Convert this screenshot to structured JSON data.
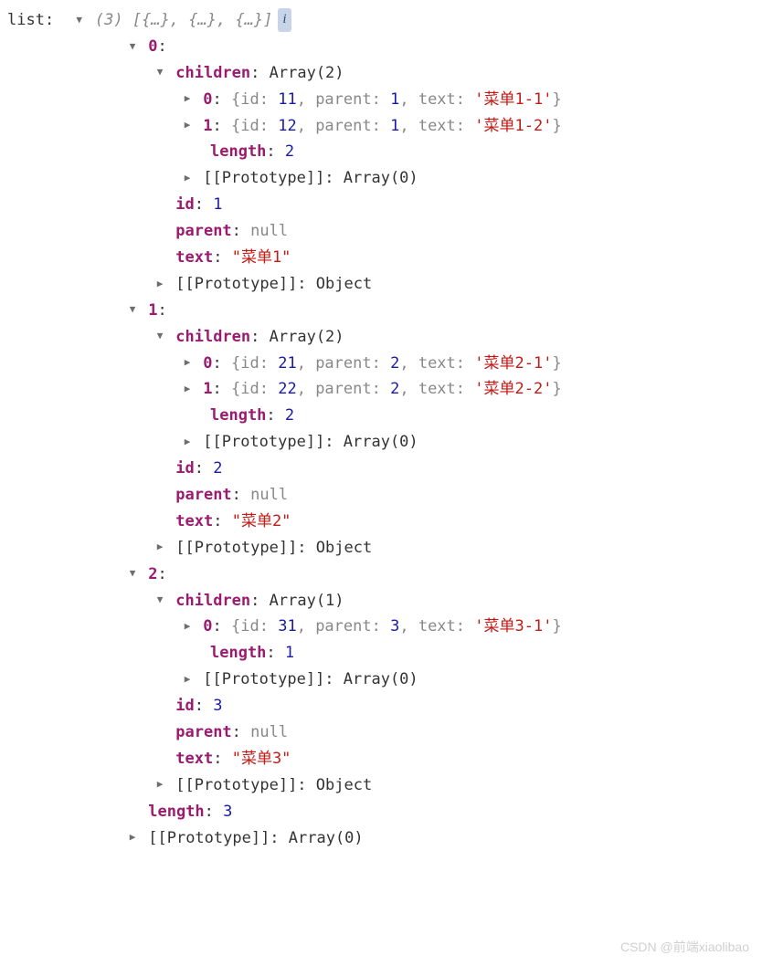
{
  "root": {
    "label": "list",
    "summary_count": "(3)",
    "summary_preview": "[{…}, {…}, {…}]",
    "info_badge": "i"
  },
  "items": [
    {
      "index": "0",
      "children_label": "children",
      "children_summary": "Array(2)",
      "child_rows": [
        {
          "idx": "0",
          "id": "11",
          "parent": "1",
          "text": "'菜单1-1'"
        },
        {
          "idx": "1",
          "id": "12",
          "parent": "1",
          "text": "'菜单1-2'"
        }
      ],
      "children_length": "2",
      "children_proto": "Array(0)",
      "id": "1",
      "parent": "null",
      "text": "\"菜单1\"",
      "proto": "Object"
    },
    {
      "index": "1",
      "children_label": "children",
      "children_summary": "Array(2)",
      "child_rows": [
        {
          "idx": "0",
          "id": "21",
          "parent": "2",
          "text": "'菜单2-1'"
        },
        {
          "idx": "1",
          "id": "22",
          "parent": "2",
          "text": "'菜单2-2'"
        }
      ],
      "children_length": "2",
      "children_proto": "Array(0)",
      "id": "2",
      "parent": "null",
      "text": "\"菜单2\"",
      "proto": "Object"
    },
    {
      "index": "2",
      "children_label": "children",
      "children_summary": "Array(1)",
      "child_rows": [
        {
          "idx": "0",
          "id": "31",
          "parent": "3",
          "text": "'菜单3-1'"
        }
      ],
      "children_length": "1",
      "children_proto": "Array(0)",
      "id": "3",
      "parent": "null",
      "text": "\"菜单3\"",
      "proto": "Object"
    }
  ],
  "outer_length": "3",
  "outer_proto": "Array(0)",
  "labels": {
    "id": "id",
    "parent": "parent",
    "text": "text",
    "length": "length",
    "prototype": "[[Prototype]]"
  },
  "watermark": "CSDN @前端xiaolibao"
}
